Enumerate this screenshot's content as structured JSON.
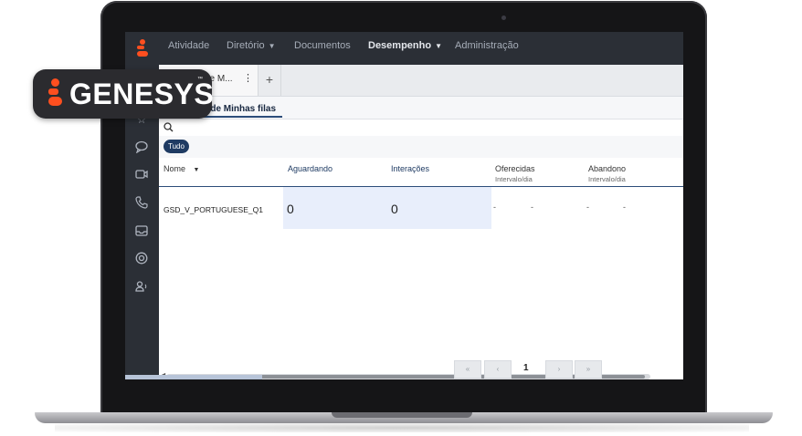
{
  "logo": {
    "text": "GENESYS",
    "trademark": "™",
    "mark_color": "#ff4f1f"
  },
  "topnav": {
    "items": [
      {
        "label": "Atividade",
        "active": false,
        "dropdown": false
      },
      {
        "label": "Diretório",
        "active": false,
        "dropdown": true
      },
      {
        "label": "Documentos",
        "active": false,
        "dropdown": false
      },
      {
        "label": "Desempenho",
        "active": true,
        "dropdown": true
      },
      {
        "label": "Administração",
        "active": false,
        "dropdown": false
      }
    ]
  },
  "sidebar": {
    "icons": [
      "star-icon",
      "chat-icon",
      "video-icon",
      "phone-icon",
      "inbox-icon",
      "support-icon",
      "agent-voice-icon"
    ]
  },
  "tabs": {
    "active_tab_label": "de M...",
    "add_label": "+"
  },
  "subtab": {
    "label": "e de Minhas filas"
  },
  "filter": {
    "chip_label": "Tudo"
  },
  "table": {
    "columns": [
      {
        "label": "Nome",
        "sub": "",
        "sort": "▼"
      },
      {
        "label": "Aguardando",
        "sub": ""
      },
      {
        "label": "Interações",
        "sub": ""
      },
      {
        "label": "Oferecidas",
        "sub": "Intervalo/dia"
      },
      {
        "label": "Abandono",
        "sub": "Intervalo/dia"
      }
    ],
    "rows": [
      {
        "name": "GSD_V_PORTUGUESE_Q1",
        "waiting": "0",
        "interactions": "0",
        "offered_a": "-",
        "offered_b": "-",
        "abandon_a": "-",
        "abandon_b": "-"
      }
    ]
  },
  "pagination": {
    "first": "«",
    "prev": "‹",
    "page": "1",
    "next": "›",
    "last": "»"
  },
  "colors": {
    "nav_bg": "#2b2f36",
    "accent": "#1f3b63",
    "highlight": "#e8eefb"
  }
}
